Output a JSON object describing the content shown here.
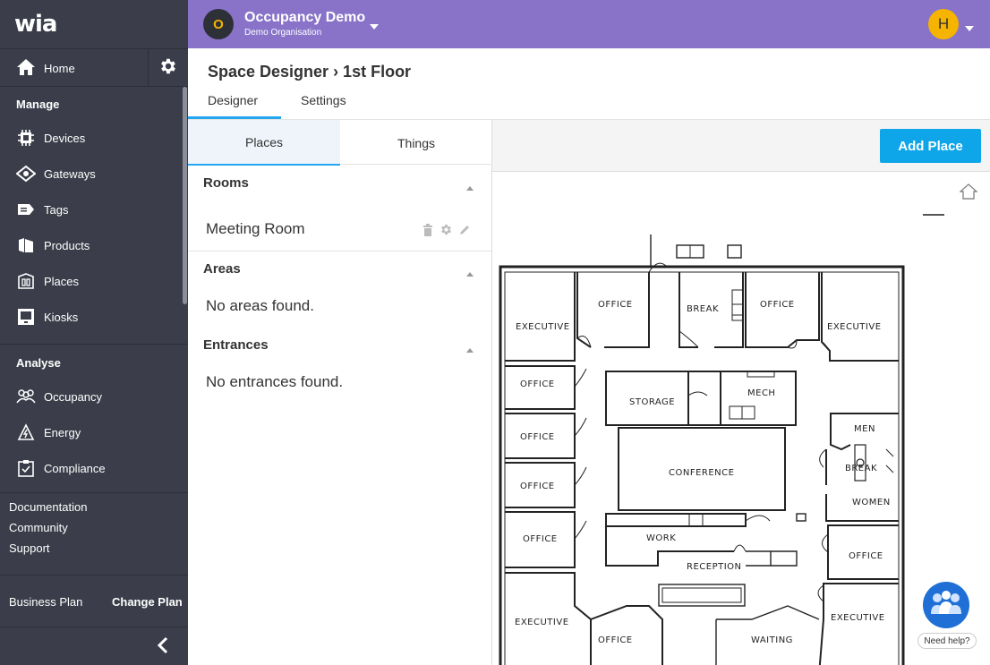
{
  "sidebar": {
    "logo": "wia",
    "home": "Home",
    "manage_title": "Manage",
    "manage_items": [
      {
        "label": "Devices",
        "icon": "devices-icon"
      },
      {
        "label": "Gateways",
        "icon": "gateways-icon"
      },
      {
        "label": "Tags",
        "icon": "tags-icon"
      },
      {
        "label": "Products",
        "icon": "products-icon"
      },
      {
        "label": "Places",
        "icon": "places-icon"
      },
      {
        "label": "Kiosks",
        "icon": "kiosks-icon"
      }
    ],
    "analyse_title": "Analyse",
    "analyse_items": [
      {
        "label": "Occupancy",
        "icon": "occupancy-icon"
      },
      {
        "label": "Energy",
        "icon": "energy-icon"
      },
      {
        "label": "Compliance",
        "icon": "compliance-icon"
      }
    ],
    "links": [
      "Documentation",
      "Community",
      "Support"
    ],
    "plan": "Business Plan",
    "change_plan": "Change Plan"
  },
  "topbar": {
    "org_initial": "O",
    "org_name": "Occupancy Demo",
    "org_sub": "Demo Organisation",
    "user_initial": "H",
    "color": "#8873c9",
    "accent": "#f5b400"
  },
  "page": {
    "title": "Space Designer › 1st Floor",
    "tabs": [
      "Designer",
      "Settings"
    ],
    "active_tab": "Designer"
  },
  "panel": {
    "tabs": [
      "Places",
      "Things"
    ],
    "active_tab": "Places",
    "rooms_title": "Rooms",
    "rooms": [
      "Meeting Room"
    ],
    "areas_title": "Areas",
    "areas_empty": "No areas found.",
    "entrances_title": "Entrances",
    "entrances_empty": "No entrances found."
  },
  "toolbar": {
    "add_place": "Add Place",
    "accent": "#0ea5e9"
  },
  "floorplan": {
    "labels": {
      "executive_tl": "EXECUTIVE",
      "office_t1": "OFFICE",
      "break_t": "BREAK",
      "office_t2": "OFFICE",
      "executive_tr": "EXECUTIVE",
      "office_l1": "OFFICE",
      "office_l2": "OFFICE",
      "office_l3": "OFFICE",
      "office_l4": "OFFICE",
      "storage": "STORAGE",
      "mech": "MECH",
      "conference": "CONFERENCE",
      "men": "MEN",
      "break_r": "BREAK",
      "women": "WOMEN",
      "work": "WORK",
      "reception": "RECEPTION",
      "office_r": "OFFICE",
      "executive_bl": "EXECUTIVE",
      "office_b": "OFFICE",
      "waiting": "WAITING",
      "executive_br": "EXECUTIVE"
    }
  },
  "help": {
    "label": "Need help?"
  }
}
